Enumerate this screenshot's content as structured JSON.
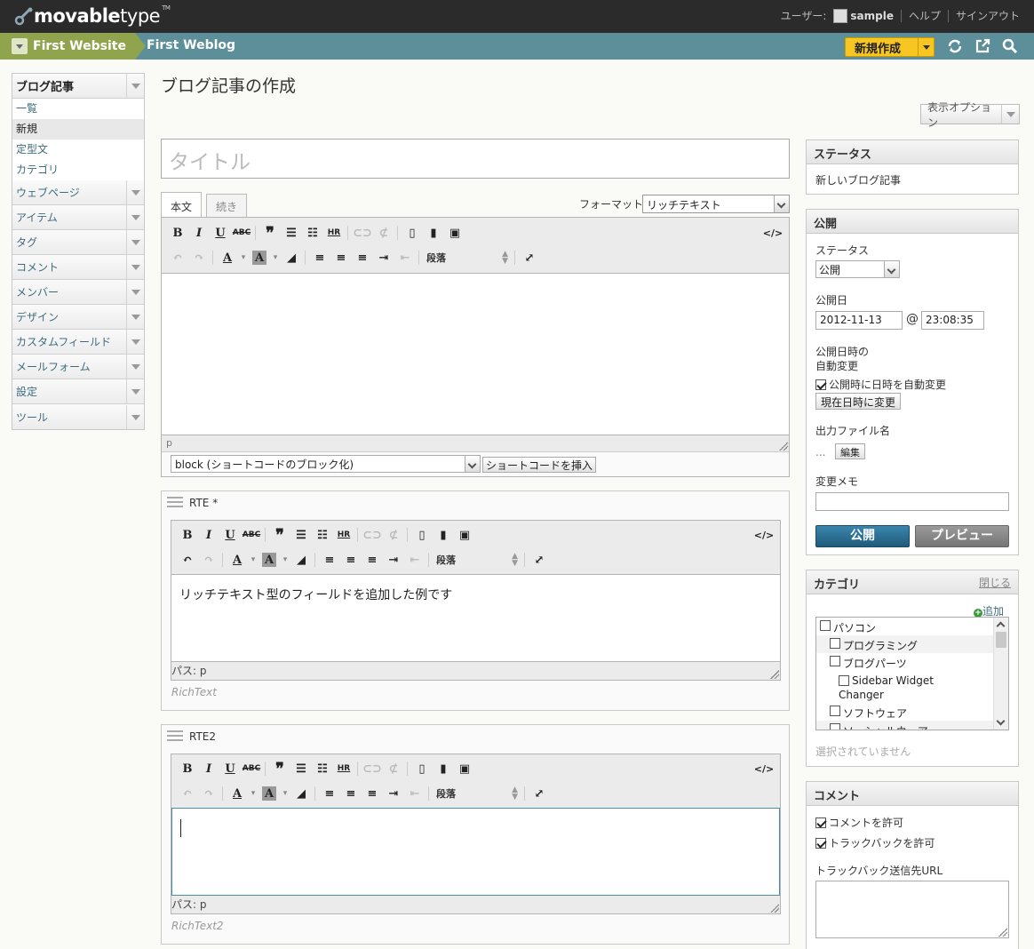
{
  "app": {
    "logo_main": "movable",
    "logo_sub": "type",
    "logo_tm": "TM"
  },
  "usernav": {
    "user_label": "ユーザー:",
    "username": "sample",
    "help": "ヘルプ",
    "signout": "サインアウト"
  },
  "sitebar": {
    "website": "First Website",
    "blog": "First Weblog",
    "new_button": "新規作成"
  },
  "sidebar": {
    "active": {
      "label": "ブログ記事",
      "items": [
        "一覧",
        "新規",
        "定型文",
        "カテゴリ"
      ]
    },
    "menus": [
      "ウェブページ",
      "アイテム",
      "タグ",
      "コメント",
      "メンバー",
      "デザイン",
      "カスタムフィールド",
      "メールフォーム",
      "設定",
      "ツール"
    ]
  },
  "main": {
    "title": "ブログ記事の作成",
    "display_options": "表示オプション",
    "title_placeholder": "タイトル",
    "tabs": [
      "本文",
      "続き"
    ],
    "format_label": "フォーマット:",
    "format_value": "リッチテキスト",
    "format_block": "段落",
    "path_main": "p",
    "shortcode_select": "block (ショートコードのブロック化)",
    "shortcode_button": "ショートコードを挿入",
    "field1": {
      "label": "RTE *",
      "content": "リッチテキスト型のフィールドを追加した例です",
      "path": "パス: p",
      "note": "RichText"
    },
    "field2": {
      "label": "RTE2",
      "content": "",
      "path": "パス: p",
      "note": "RichText2"
    }
  },
  "toolbar": {
    "bold": "B",
    "italic": "I",
    "underline": "U",
    "strike": "ABC",
    "quote": "❞",
    "hr": "HR",
    "source": "</>"
  },
  "status_panel": {
    "title": "ステータス",
    "value": "新しいブログ記事"
  },
  "publish_panel": {
    "title": "公開",
    "status_label": "ステータス",
    "status_value": "公開",
    "date_label": "公開日",
    "date": "2012-11-13",
    "at": "@",
    "time": "23:08:35",
    "auto_label1": "公開日時の",
    "auto_label2": "自動変更",
    "auto_check": "公開時に日時を自動変更",
    "now_button": "現在日時に変更",
    "file_label": "出力ファイル名",
    "file_value": "...",
    "edit_button": "編集",
    "memo_label": "変更メモ",
    "publish_button": "公開",
    "preview_button": "プレビュー"
  },
  "category_panel": {
    "title": "カテゴリ",
    "close": "閉じる",
    "add": "追加",
    "items": [
      {
        "label": "パソコン",
        "level": 0
      },
      {
        "label": "プログラミング",
        "level": 1
      },
      {
        "label": "ブログパーツ",
        "level": 1
      },
      {
        "label": "Sidebar Widget Changer",
        "level": 2
      },
      {
        "label": "ソフトウェア",
        "level": 1
      },
      {
        "label": "ソーシャルウェア",
        "level": 1
      }
    ],
    "none_selected": "選択されていません"
  },
  "comment_panel": {
    "title": "コメント",
    "allow_comments": "コメントを許可",
    "allow_trackbacks": "トラックバックを許可",
    "tb_url_label": "トラックバック送信先URL"
  },
  "colors": {
    "topbar": "#2b2b2b",
    "sitebar": "#5c8f9a",
    "website": "#8fa44c",
    "new_button": "#f7c623",
    "publish": "#2c6f91",
    "preview": "#8a8a8a",
    "link": "#3d6c7e"
  }
}
